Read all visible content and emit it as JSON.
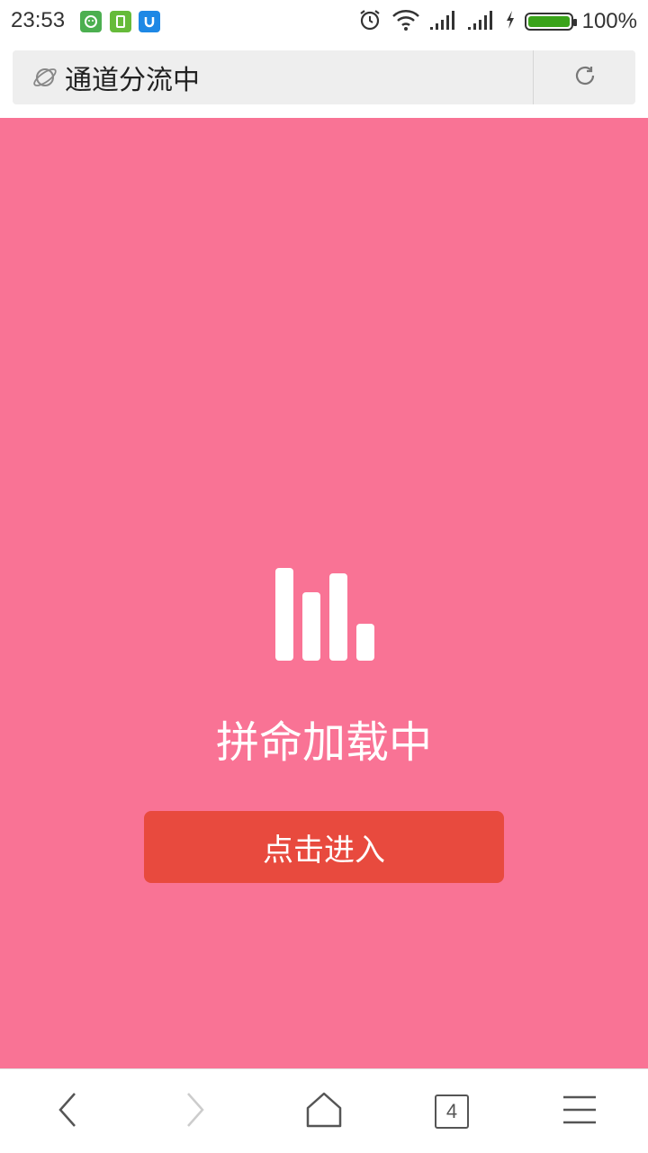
{
  "status_bar": {
    "time": "23:53",
    "battery_percent": "100%",
    "battery_level": 1.0,
    "notification_icons": [
      "android-face-icon",
      "sim-card-icon",
      "u-app-icon"
    ],
    "indicator_icons": [
      "alarm-clock-icon",
      "wifi-icon",
      "signal-bars-icon",
      "signal-bars-icon",
      "charging-bolt-icon",
      "battery-icon"
    ]
  },
  "url_bar": {
    "title": "通道分流中",
    "left_icon": "planet-icon",
    "right_icon": "refresh-icon"
  },
  "main": {
    "background_color": "#f97395",
    "loader_icon": "bar-chart-loader-icon",
    "loading_text": "拼命加载中",
    "enter_button_label": "点击进入",
    "enter_button_color": "#e84a3e"
  },
  "bottom_nav": {
    "items": [
      "back-icon",
      "forward-icon",
      "home-icon",
      "tabs-icon",
      "menu-icon"
    ],
    "tab_count": "4"
  }
}
